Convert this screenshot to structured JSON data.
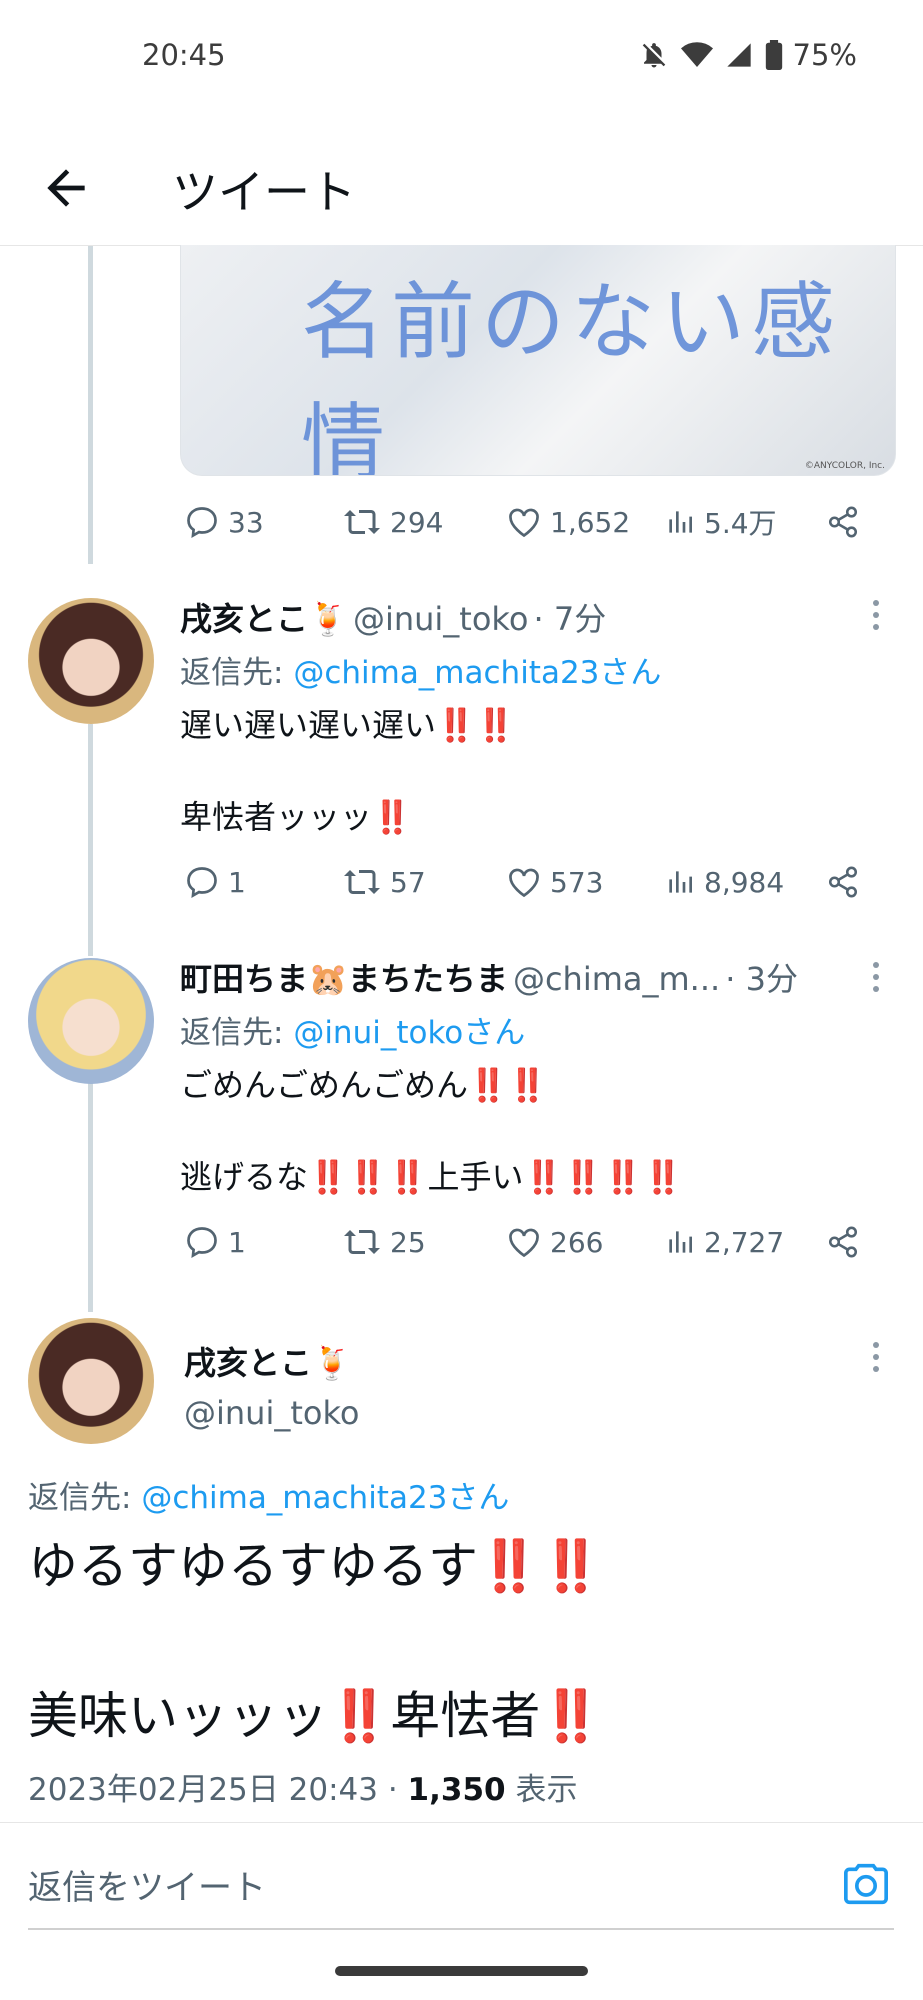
{
  "status": {
    "time": "20:45",
    "battery": "75%"
  },
  "header": {
    "title": "ツイート"
  },
  "media": {
    "title_text": "名前のない感情",
    "credit": "©ANYCOLOR, Inc."
  },
  "tweet1_actions": {
    "replies": "33",
    "retweets": "294",
    "likes": "1,652",
    "views": "5.4万"
  },
  "tweet2": {
    "name": "戌亥とこ🍹",
    "handle": "@inui_toko",
    "time": "· 7分",
    "reply_label": "返信先: ",
    "reply_mention": "@chima_machita23さん",
    "line1": "遅い遅い遅い遅い",
    "bang1": "‼️‼️",
    "line2": "卑怯者ッッッ",
    "bang2": "‼️",
    "replies": "1",
    "retweets": "57",
    "likes": "573",
    "views": "8,984"
  },
  "tweet3": {
    "name": "町田ちま🐹まちたちま",
    "handle": "@chima_m...",
    "time": "· 3分",
    "reply_label": "返信先: ",
    "reply_mention": "@inui_tokoさん",
    "line1": "ごめんごめんごめん",
    "bang1": "‼️‼️",
    "line2a": "逃げるな",
    "bang2a": "‼️‼️‼️",
    "line2b": "上手い",
    "bang2b": "‼️‼️‼️‼️",
    "replies": "1",
    "retweets": "25",
    "likes": "266",
    "views": "2,727"
  },
  "main_tweet": {
    "name": "戌亥とこ🍹",
    "handle": "@inui_toko",
    "reply_label": "返信先: ",
    "reply_mention": "@chima_machita23さん",
    "line1": "ゆるすゆるすゆるす",
    "bang1": "‼️‼️",
    "line2a": "美味いッッッ",
    "bang2a": "‼️",
    "line2b": "卑怯者",
    "bang2b": "‼️",
    "timestamp": "2023年02月25日 20:43 · ",
    "view_count": "1,350",
    "view_label": " 表示"
  },
  "composer": {
    "placeholder": "返信をツイート"
  },
  "colors": {
    "accent": "#1d9bf0",
    "bang": "#e0245e",
    "muted": "#536471"
  }
}
